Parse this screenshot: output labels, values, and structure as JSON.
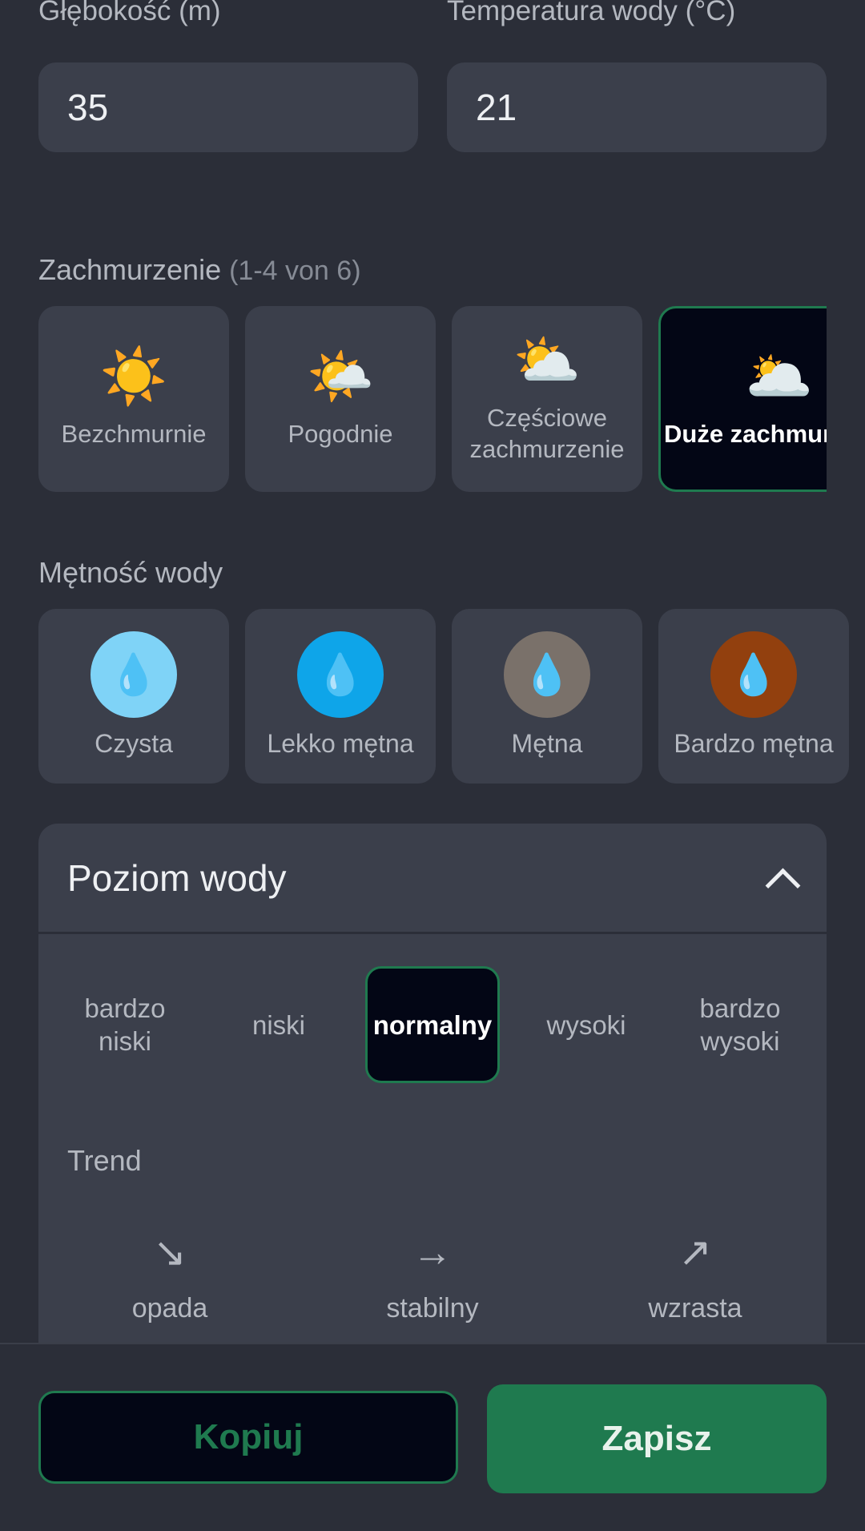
{
  "depth": {
    "label": "Głębokość (m)",
    "value": "35"
  },
  "water_temp": {
    "label": "Temperatura wody (°C)",
    "value": "21"
  },
  "clouds": {
    "label": "Zachmurzenie",
    "hint": "(1-4 von 6)",
    "options": [
      {
        "emoji": "☀️",
        "label": "Bezchmurnie"
      },
      {
        "emoji": "🌤️",
        "label": "Pogodnie"
      },
      {
        "emoji": "⛅",
        "label": "Częściowe zachmurzenie"
      },
      {
        "emoji": "🌥️",
        "label": "Duże zachmurzenie",
        "selected": true
      }
    ]
  },
  "turbidity": {
    "label": "Mętność wody",
    "options": [
      {
        "icon": "droplet-icon",
        "label": "Czysta",
        "color": "#7fd3f7"
      },
      {
        "icon": "droplet-icon",
        "label": "Lekko mętna",
        "color": "#0ea5e9"
      },
      {
        "icon": "droplet-icon",
        "label": "Mętna",
        "color": "#7a716a"
      },
      {
        "icon": "droplet-icon",
        "label": "Bardzo mętna",
        "color": "#92400e"
      }
    ]
  },
  "water_level": {
    "title": "Poziom wody",
    "levels": [
      {
        "label": "bardzo niski"
      },
      {
        "label": "niski"
      },
      {
        "label": "normalny",
        "selected": true
      },
      {
        "label": "wysoki"
      },
      {
        "label": "bardzo wysoki"
      }
    ],
    "trend_label": "Trend",
    "trends": [
      {
        "arrow": "↘",
        "label": "opada"
      },
      {
        "arrow": "→",
        "label": "stabilny"
      },
      {
        "arrow": "↗",
        "label": "wzrasta"
      }
    ]
  },
  "actions": {
    "copy": "Kopiuj",
    "save": "Zapisz"
  },
  "colors": {
    "accent": "#1f7a4f",
    "background": "#2b2e38",
    "surface": "#3b3f4b",
    "selected_bg": "#030615"
  }
}
